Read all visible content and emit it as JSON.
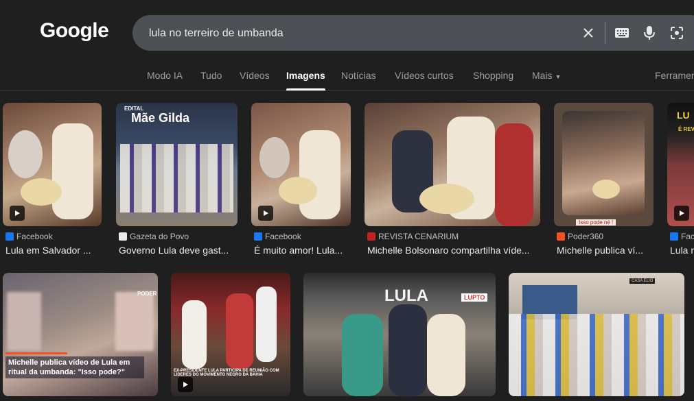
{
  "logo": "Google",
  "search": {
    "value": "lula no terreiro de umbanda"
  },
  "tabs": [
    {
      "label": "Modo IA"
    },
    {
      "label": "Tudo"
    },
    {
      "label": "Vídeos"
    },
    {
      "label": "Imagens"
    },
    {
      "label": "Notícias"
    },
    {
      "label": "Vídeos curtos"
    },
    {
      "label": "Shopping"
    },
    {
      "label": "Mais"
    },
    {
      "label": "Ferramentas"
    }
  ],
  "results_row1": [
    {
      "source": "Facebook",
      "title": "Lula em Salvador ..."
    },
    {
      "source": "Gazeta do Povo",
      "title": "Governo Lula deve gast..."
    },
    {
      "source": "Facebook",
      "title": "É muito amor! Lula..."
    },
    {
      "source": "REVISTA CENARIUM",
      "title": "Michelle Bolsonaro compartilha víde..."
    },
    {
      "source": "Poder360",
      "title": "Michelle publica ví..."
    },
    {
      "source": "Fac",
      "title": "Lula n"
    }
  ],
  "thumb_text": {
    "t2_edital": "EDITAL",
    "t2_name": "Mãe Gilda",
    "t5_caption": "Isso pode né !",
    "t6_lu": "LU",
    "t6_e": "É REVE",
    "r2_t1_brand": "PODER",
    "r2_t1_headline": "Michelle publica vídeo de Lula em ritual da umbanda: \"Isso pode?\"",
    "r2_t2_headline": "EX-PRESIDENTE LULA PARTICIPA DE REUNIÃO COM LÍDERES DO MOVIMENTO NEGRO DA BAHIA",
    "r2_t3_sign": "LULA",
    "r2_t3_badge": "LUPTO",
    "r2_t4_sign": "CASA ELIO"
  },
  "colors": {
    "background": "#1f1f1f",
    "searchbar": "#4d5156",
    "facebook": "#1877f2",
    "gazeta": "#e8eaed",
    "cenarium": "#c5221f",
    "poder360": "#f4511e"
  }
}
